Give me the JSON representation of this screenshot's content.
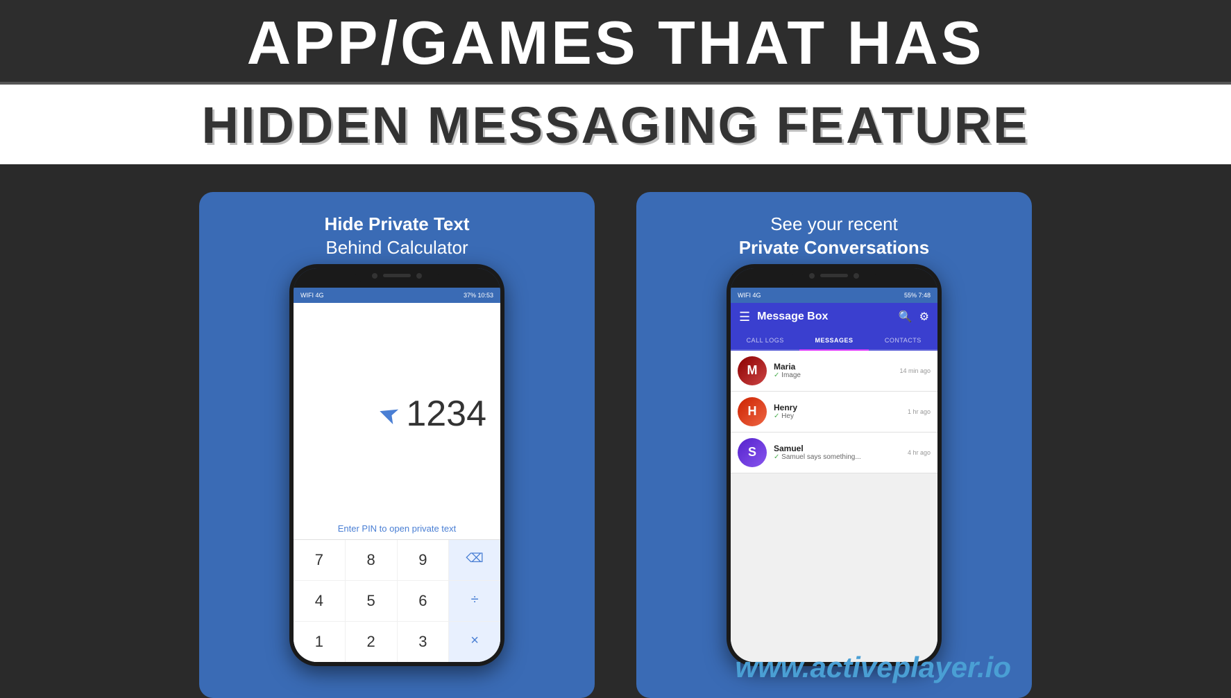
{
  "header": {
    "title_main": "APP/GAMES THAT HAS",
    "title_sub": "HIDDEN MESSAGING FEATURE"
  },
  "left_card": {
    "title_bold": "Hide Private Text",
    "title_normal": "Behind Calculator",
    "calc": {
      "number": "1234",
      "hint": "Enter PIN to open private text",
      "buttons": [
        {
          "label": "7",
          "type": "num"
        },
        {
          "label": "8",
          "type": "num"
        },
        {
          "label": "9",
          "type": "num"
        },
        {
          "label": "⌫",
          "type": "backspace"
        },
        {
          "label": "4",
          "type": "num"
        },
        {
          "label": "5",
          "type": "num"
        },
        {
          "label": "6",
          "type": "num"
        },
        {
          "label": "÷",
          "type": "op"
        },
        {
          "label": "1",
          "type": "num"
        },
        {
          "label": "2",
          "type": "num"
        },
        {
          "label": "3",
          "type": "num"
        },
        {
          "label": "×",
          "type": "op"
        }
      ],
      "status_bar": {
        "left": "WIFI 4G",
        "right": "37%  10:53"
      }
    }
  },
  "right_card": {
    "title_line1": "See your recent",
    "title_line2": "Private Conversations",
    "app": {
      "header_title": "Message Box",
      "tabs": [
        "CALL LOGS",
        "MESSAGES",
        "CONTACTS"
      ],
      "active_tab": "MESSAGES",
      "status_bar": {
        "left": "WIFI 4G",
        "right": "55%  7:48"
      },
      "messages": [
        {
          "name": "Maria",
          "preview": "Image",
          "time": "14 min ago",
          "avatar_class": "avatar-maria"
        },
        {
          "name": "Henry",
          "preview": "Hey",
          "time": "1 hr ago",
          "avatar_class": "avatar-henry"
        },
        {
          "name": "Samuel",
          "preview": "Samuel says something...",
          "time": "4 hr ago",
          "avatar_class": "avatar-samuel"
        }
      ]
    }
  },
  "watermark": {
    "text": "www.activeplayer.io"
  }
}
